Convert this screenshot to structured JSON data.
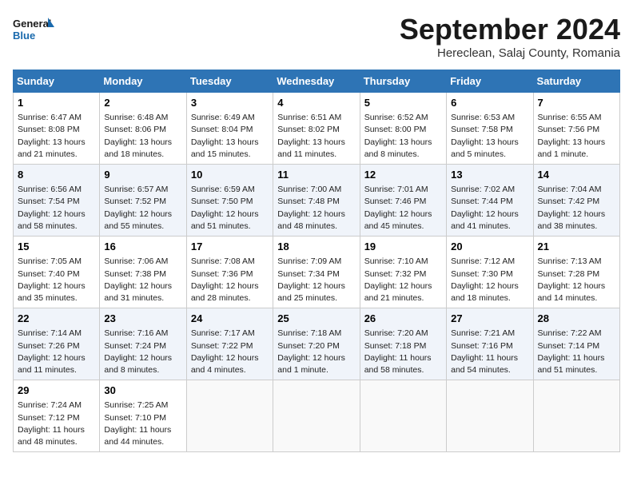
{
  "logo": {
    "line1": "General",
    "line2": "Blue"
  },
  "title": "September 2024",
  "subtitle": "Hereclean, Salaj County, Romania",
  "days_of_week": [
    "Sunday",
    "Monday",
    "Tuesday",
    "Wednesday",
    "Thursday",
    "Friday",
    "Saturday"
  ],
  "weeks": [
    [
      {
        "day": "1",
        "info": "Sunrise: 6:47 AM\nSunset: 8:08 PM\nDaylight: 13 hours\nand 21 minutes."
      },
      {
        "day": "2",
        "info": "Sunrise: 6:48 AM\nSunset: 8:06 PM\nDaylight: 13 hours\nand 18 minutes."
      },
      {
        "day": "3",
        "info": "Sunrise: 6:49 AM\nSunset: 8:04 PM\nDaylight: 13 hours\nand 15 minutes."
      },
      {
        "day": "4",
        "info": "Sunrise: 6:51 AM\nSunset: 8:02 PM\nDaylight: 13 hours\nand 11 minutes."
      },
      {
        "day": "5",
        "info": "Sunrise: 6:52 AM\nSunset: 8:00 PM\nDaylight: 13 hours\nand 8 minutes."
      },
      {
        "day": "6",
        "info": "Sunrise: 6:53 AM\nSunset: 7:58 PM\nDaylight: 13 hours\nand 5 minutes."
      },
      {
        "day": "7",
        "info": "Sunrise: 6:55 AM\nSunset: 7:56 PM\nDaylight: 13 hours\nand 1 minute."
      }
    ],
    [
      {
        "day": "8",
        "info": "Sunrise: 6:56 AM\nSunset: 7:54 PM\nDaylight: 12 hours\nand 58 minutes."
      },
      {
        "day": "9",
        "info": "Sunrise: 6:57 AM\nSunset: 7:52 PM\nDaylight: 12 hours\nand 55 minutes."
      },
      {
        "day": "10",
        "info": "Sunrise: 6:59 AM\nSunset: 7:50 PM\nDaylight: 12 hours\nand 51 minutes."
      },
      {
        "day": "11",
        "info": "Sunrise: 7:00 AM\nSunset: 7:48 PM\nDaylight: 12 hours\nand 48 minutes."
      },
      {
        "day": "12",
        "info": "Sunrise: 7:01 AM\nSunset: 7:46 PM\nDaylight: 12 hours\nand 45 minutes."
      },
      {
        "day": "13",
        "info": "Sunrise: 7:02 AM\nSunset: 7:44 PM\nDaylight: 12 hours\nand 41 minutes."
      },
      {
        "day": "14",
        "info": "Sunrise: 7:04 AM\nSunset: 7:42 PM\nDaylight: 12 hours\nand 38 minutes."
      }
    ],
    [
      {
        "day": "15",
        "info": "Sunrise: 7:05 AM\nSunset: 7:40 PM\nDaylight: 12 hours\nand 35 minutes."
      },
      {
        "day": "16",
        "info": "Sunrise: 7:06 AM\nSunset: 7:38 PM\nDaylight: 12 hours\nand 31 minutes."
      },
      {
        "day": "17",
        "info": "Sunrise: 7:08 AM\nSunset: 7:36 PM\nDaylight: 12 hours\nand 28 minutes."
      },
      {
        "day": "18",
        "info": "Sunrise: 7:09 AM\nSunset: 7:34 PM\nDaylight: 12 hours\nand 25 minutes."
      },
      {
        "day": "19",
        "info": "Sunrise: 7:10 AM\nSunset: 7:32 PM\nDaylight: 12 hours\nand 21 minutes."
      },
      {
        "day": "20",
        "info": "Sunrise: 7:12 AM\nSunset: 7:30 PM\nDaylight: 12 hours\nand 18 minutes."
      },
      {
        "day": "21",
        "info": "Sunrise: 7:13 AM\nSunset: 7:28 PM\nDaylight: 12 hours\nand 14 minutes."
      }
    ],
    [
      {
        "day": "22",
        "info": "Sunrise: 7:14 AM\nSunset: 7:26 PM\nDaylight: 12 hours\nand 11 minutes."
      },
      {
        "day": "23",
        "info": "Sunrise: 7:16 AM\nSunset: 7:24 PM\nDaylight: 12 hours\nand 8 minutes."
      },
      {
        "day": "24",
        "info": "Sunrise: 7:17 AM\nSunset: 7:22 PM\nDaylight: 12 hours\nand 4 minutes."
      },
      {
        "day": "25",
        "info": "Sunrise: 7:18 AM\nSunset: 7:20 PM\nDaylight: 12 hours\nand 1 minute."
      },
      {
        "day": "26",
        "info": "Sunrise: 7:20 AM\nSunset: 7:18 PM\nDaylight: 11 hours\nand 58 minutes."
      },
      {
        "day": "27",
        "info": "Sunrise: 7:21 AM\nSunset: 7:16 PM\nDaylight: 11 hours\nand 54 minutes."
      },
      {
        "day": "28",
        "info": "Sunrise: 7:22 AM\nSunset: 7:14 PM\nDaylight: 11 hours\nand 51 minutes."
      }
    ],
    [
      {
        "day": "29",
        "info": "Sunrise: 7:24 AM\nSunset: 7:12 PM\nDaylight: 11 hours\nand 48 minutes."
      },
      {
        "day": "30",
        "info": "Sunrise: 7:25 AM\nSunset: 7:10 PM\nDaylight: 11 hours\nand 44 minutes."
      },
      {
        "day": "",
        "info": ""
      },
      {
        "day": "",
        "info": ""
      },
      {
        "day": "",
        "info": ""
      },
      {
        "day": "",
        "info": ""
      },
      {
        "day": "",
        "info": ""
      }
    ]
  ]
}
